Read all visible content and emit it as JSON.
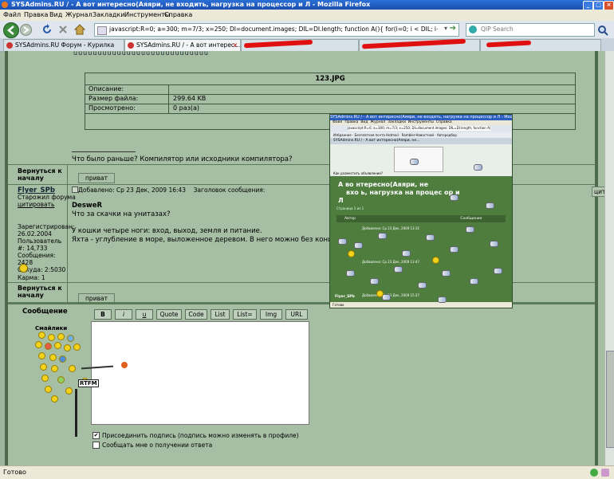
{
  "window": {
    "title": "SYSAdmins.RU / - А вот интересно(Аяяри, не входить, нагрузка на процессор и Л - Mozilla Firefox"
  },
  "menu": [
    "Файл",
    "Правка",
    "Вид",
    "Журнал",
    "Закладки",
    "Инструменты",
    "Справка"
  ],
  "nav": {
    "url": "javascript:R=0; a=300; m=7/3; x=250; DI=document.images; DIL=DI.length; function A(){ for(i=0; i < DIL; i++){ DIS=DI[i].style; DIS.positic",
    "search_placeholder": "QIP Search"
  },
  "tabs": [
    {
      "label": "SYSAdmins.RU Форум - Курилка"
    },
    {
      "label": "SYSAdmins.RU / - А вот интерес..."
    }
  ],
  "attachment": {
    "title": "123.JPG",
    "rows": [
      {
        "label": "Описание:",
        "value": ""
      },
      {
        "label": "Размер файла:",
        "value": "299.64 KB"
      },
      {
        "label": "Просмотрено:",
        "value": "0 раз(а)"
      }
    ],
    "top_text": "uuuuuuuuuuuuuuuuuuuuuuuuuuuu"
  },
  "post1": {
    "text": "Что было раньше? Компилятор или исходники компилятора?",
    "back": "Вернуться к началу",
    "pm": "приват"
  },
  "post2": {
    "author": "Flyer_SPb",
    "rank": "Старожил форума",
    "quote": "цитировать",
    "header": "Добавлено: Ср 23 Дек, 2009 16:43    Заголовок сообщения:",
    "reg": "Зарегистрирован: 26.02.2004",
    "user_no": "Пользователь #: 14,733",
    "posts": "Сообщения: 2428",
    "from": "Откуда: 2:5030",
    "karma": "Карма: 1",
    "quote_author": "DesweR",
    "quote_text": "Что за скачки на унитазах?",
    "line1": "У кошки четыре ноги: вход, выход, земля и питание.",
    "line2": "Яхта - углубление в море, выложенное деревом. В него можно без конца бросать",
    "back": "Вернуться к началу",
    "pm": "приват",
    "edge_btn": "цита"
  },
  "reply": {
    "label": "Сообщение",
    "smileys_label": "Смайлики",
    "buttons": [
      "B",
      "i",
      "u",
      "Quote",
      "Code",
      "List",
      "List=",
      "Img",
      "URL"
    ],
    "check1": "Присоединить подпись (подпись можно изменять в профиле)",
    "check2": "Сообщать мне о получении ответа",
    "rtfm": "RTFM"
  },
  "overlay": {
    "url": "javascript:R=0; a=300; m=7/3; x=250; DI=document.images; DIL=DI.length; function A(){ for(i=0;",
    "title": "SYSAdmins.RU / - А вот интересно(Аяяри, не входить, нагрузка на процессор и Л - Mozilla Firefox",
    "heading1": "А во нтересно(Аяяри, не",
    "heading2": "вхо ь, нагрузка на процес ор и",
    "heading3": "Л",
    "menu": [
      "Файл",
      "Правка",
      "Вид",
      "Журнал",
      "Закладки",
      "Инструменты",
      "Справка"
    ],
    "tab": "SYSAdmins.RU / - А вот интересно(Аяяри, не...",
    "bookmarks": [
      "Избранное",
      "Бесплатная почта Hotmail",
      "Rambler-Новостной",
      "Автородбор"
    ],
    "small1": "Как разместить объявление?",
    "small2": "Страница 1 из 1",
    "author": "Автор",
    "message": "Сообщение",
    "date1": "Добавлено: Ср 23 Дек, 2009 13:31",
    "date2": "Добавлено: Ср 23 Дек, 2009 13:47",
    "date3": "Добавлено: Ср 23 Дек, 2009 15:27",
    "flyer": "Flyer_SPb",
    "status_text": "Готово"
  },
  "status": {
    "text": "Готово"
  }
}
